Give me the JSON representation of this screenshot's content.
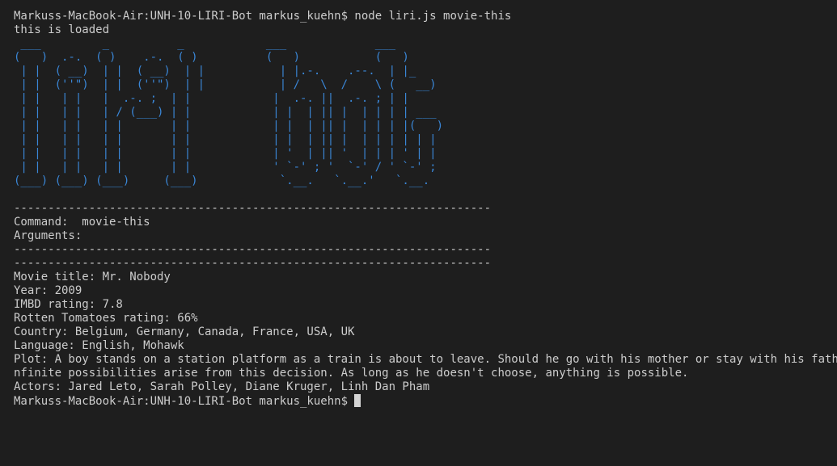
{
  "terminal": {
    "command_line": "Markuss-MacBook-Air:UNH-10-LIRI-Bot markus_kuehn$ node liri.js movie-this",
    "loaded_message": "this is loaded",
    "ascii_art": " ___         _          _            ___             ___\n(   )  .-.  ( )    .-.  ( )          (   )           (   )\n | |  ( __)  | |  ( __)  | |           | |.-.    .--.  | |_\n | |  (''\")  | |  (''\")  | |           | /   \\  /    \\ (   __)\n | |   | |   |  .-. ;  | |            |  .-. ||  .-. ; | |\n | |   | |   | / (___) | |            | |  | || |  | | | | ___\n | |   | |   | |       | |            | |  | || |  | | | |(   )\n | |   | |   | |       | |            | |  | || |  | | | | | |\n | |   | |   | |       | |            | '  | || '  | | | ' | |\n | |   | |   | |       | |            ' `-' ; '  `-' / ' `-' ;\n(___) (___) (___)     (___)            `.__.   `.__.'   `.__.\n",
    "ascii_color": "#3a86d6",
    "separator": "----------------------------------------------------------------------",
    "command_label": "Command:  movie-this",
    "arguments_label": "Arguments:",
    "movie": {
      "title": "Movie title: Mr. Nobody",
      "year": "Year: 2009",
      "imdb": "IMBD rating: 7.8",
      "rotten": "Rotten Tomatoes rating: 66%",
      "country": "Country: Belgium, Germany, Canada, France, USA, UK",
      "language": "Language: English, Mohawk",
      "plot_line1": "Plot: A boy stands on a station platform as a train is about to leave. Should he go with his mother or stay with his father? I",
      "plot_line2": "nfinite possibilities arise from this decision. As long as he doesn't choose, anything is possible.",
      "actors": "Actors: Jared Leto, Sarah Polley, Diane Kruger, Linh Dan Pham"
    },
    "prompt": "Markuss-MacBook-Air:UNH-10-LIRI-Bot markus_kuehn$ "
  }
}
